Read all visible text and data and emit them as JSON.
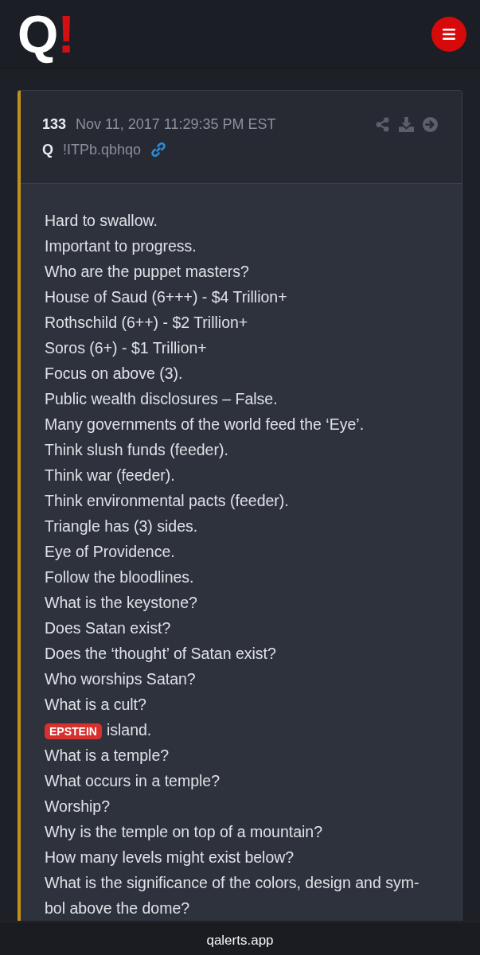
{
  "header": {
    "logo": {
      "letter": "Q",
      "mark": "!"
    }
  },
  "post": {
    "number": "133",
    "timestamp": "Nov 11, 2017 11:29:35 PM EST",
    "author": "Q",
    "tripcode": "!ITPb.qbhqo",
    "lines": [
      {
        "kind": "text",
        "text": "Hard to swallow."
      },
      {
        "kind": "text",
        "text": "Important to progress."
      },
      {
        "kind": "text",
        "text": "Who are the puppet masters?"
      },
      {
        "kind": "text",
        "text": "House of Saud (6+++) - $4 Trillion+"
      },
      {
        "kind": "text",
        "text": "Rothschild (6++) - $2 Trillion+"
      },
      {
        "kind": "text",
        "text": "Soros (6+) - $1 Trillion+"
      },
      {
        "kind": "text",
        "text": "Focus on above (3)."
      },
      {
        "kind": "text",
        "text": "Public wealth disclosures – False."
      },
      {
        "kind": "text",
        "text": "Many governments of the world feed the ‘Eye’."
      },
      {
        "kind": "text",
        "text": "Think slush funds (feeder)."
      },
      {
        "kind": "text",
        "text": "Think war (feeder)."
      },
      {
        "kind": "text",
        "text": "Think environmental pacts (feeder)."
      },
      {
        "kind": "text",
        "text": "Triangle has (3) sides."
      },
      {
        "kind": "text",
        "text": "Eye of Providence."
      },
      {
        "kind": "text",
        "text": "Follow the bloodlines."
      },
      {
        "kind": "text",
        "text": "What is the keystone?"
      },
      {
        "kind": "text",
        "text": "Does Satan exist?"
      },
      {
        "kind": "text",
        "text": "Does the ‘thought’ of Satan exist?"
      },
      {
        "kind": "text",
        "text": "Who worships Satan?"
      },
      {
        "kind": "text",
        "text": "What is a cult?"
      },
      {
        "kind": "tagged",
        "tag": "EPSTEIN",
        "text": "island."
      },
      {
        "kind": "text",
        "text": "What is a temple?"
      },
      {
        "kind": "text",
        "text": "What occurs in a temple?"
      },
      {
        "kind": "text",
        "text": "Worship?"
      },
      {
        "kind": "text",
        "text": "Why is the temple on top of a mountain?"
      },
      {
        "kind": "text",
        "text": "How many levels might exist below?"
      },
      {
        "kind": "text",
        "text": "What is the significance of the colors, design and sym-"
      },
      {
        "kind": "text",
        "text": "bol above the dome?"
      }
    ]
  },
  "address_bar": {
    "url": "qalerts.app"
  }
}
